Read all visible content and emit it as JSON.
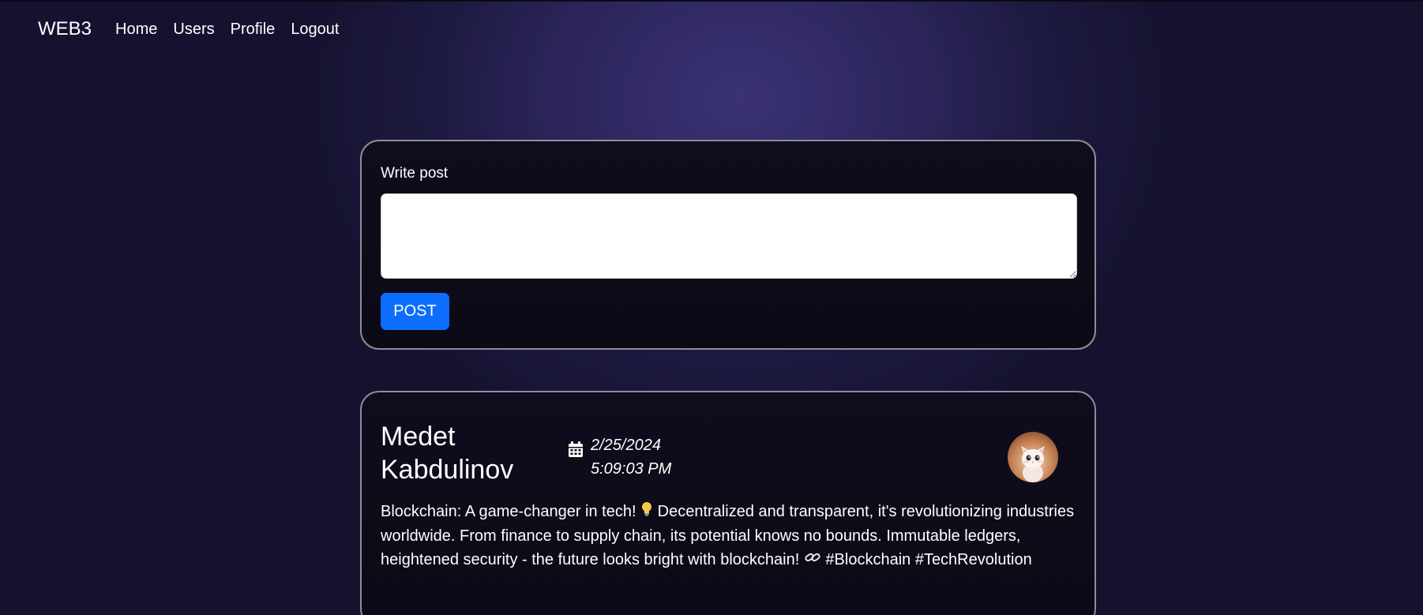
{
  "nav": {
    "brand": "WEB3",
    "links": [
      "Home",
      "Users",
      "Profile",
      "Logout"
    ]
  },
  "compose": {
    "label": "Write post",
    "textarea_value": "",
    "button_label": "POST"
  },
  "post": {
    "author": "Medet Kabdulinov",
    "date": "2/25/2024",
    "time": "5:09:03 PM",
    "body_part1": "Blockchain: A game-changer in tech! ",
    "emoji1": "lightbulb-icon",
    "body_part2": " Decentralized and transparent, it's revolutionizing industries worldwide. From finance to supply chain, its potential knows no bounds. Immutable ledgers, heightened security - the future looks bright with blockchain! ",
    "emoji2": "link-icon",
    "body_part3": " #Blockchain #TechRevolution"
  },
  "colors": {
    "primary_button": "#0d6efd",
    "card_background": "#0d0b18",
    "card_border": "#8f8c9a",
    "page_background": "#2a2458"
  }
}
